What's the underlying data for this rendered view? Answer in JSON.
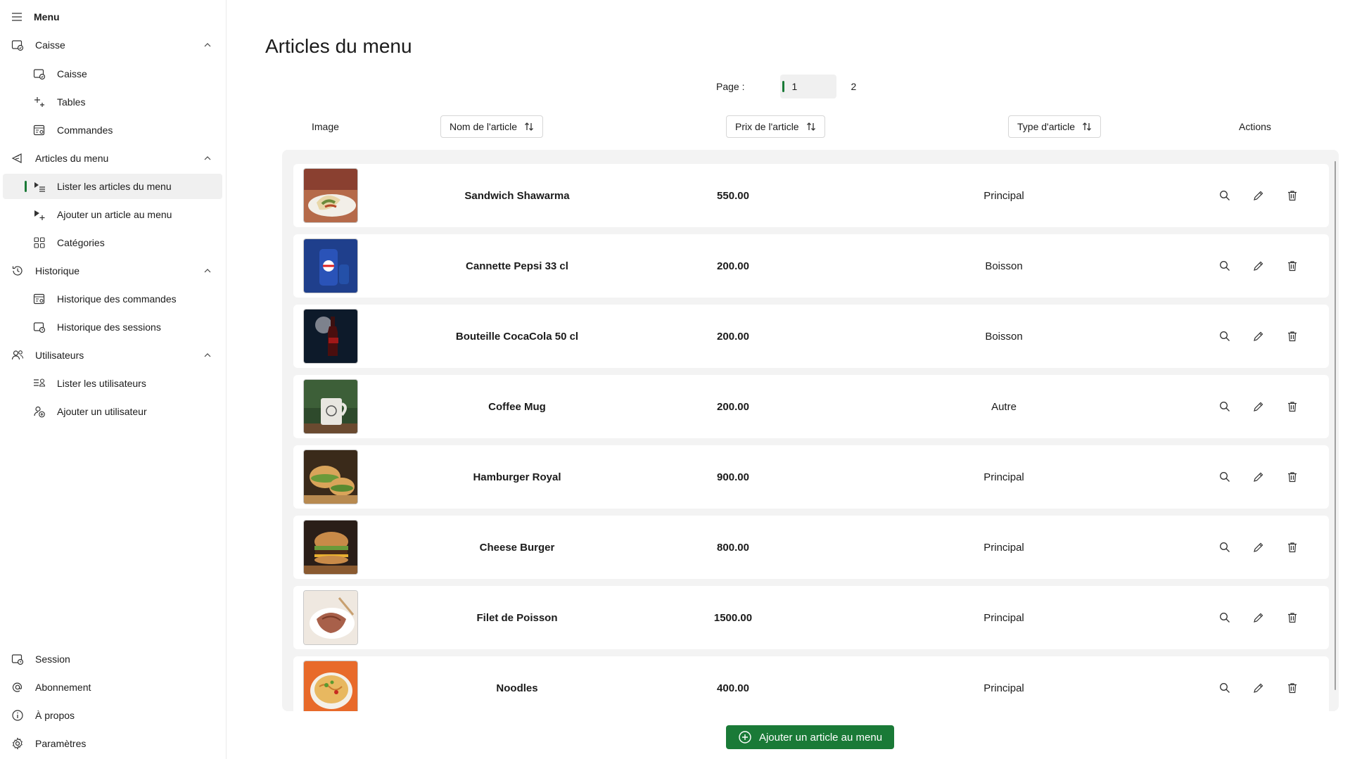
{
  "sidebar": {
    "menu_label": "Menu",
    "caisse_group": "Caisse",
    "caisse": "Caisse",
    "tables": "Tables",
    "commandes": "Commandes",
    "articles_group": "Articles du menu",
    "lister_articles": "Lister les articles du menu",
    "ajouter_article": "Ajouter un article au menu",
    "categories": "Catégories",
    "historique_group": "Historique",
    "historique_commandes": "Historique des commandes",
    "historique_sessions": "Historique des sessions",
    "utilisateurs_group": "Utilisateurs",
    "lister_utilisateurs": "Lister les utilisateurs",
    "ajouter_utilisateur": "Ajouter un utilisateur",
    "session": "Session",
    "abonnement": "Abonnement",
    "apropos": "À propos",
    "parametres": "Paramètres"
  },
  "main": {
    "title": "Articles du menu",
    "page_label": "Page :",
    "page_current": "1",
    "page_next": "2",
    "columns": {
      "image": "Image",
      "name": "Nom de l'article",
      "price": "Prix de l'article",
      "type": "Type d'article",
      "actions": "Actions"
    },
    "items": [
      {
        "name": "Sandwich Shawarma",
        "price": "550.00",
        "type": "Principal"
      },
      {
        "name": "Cannette Pepsi 33 cl",
        "price": "200.00",
        "type": "Boisson"
      },
      {
        "name": "Bouteille CocaCola 50 cl",
        "price": "200.00",
        "type": "Boisson"
      },
      {
        "name": "Coffee Mug",
        "price": "200.00",
        "type": "Autre"
      },
      {
        "name": "Hamburger Royal",
        "price": "900.00",
        "type": "Principal"
      },
      {
        "name": "Cheese Burger",
        "price": "800.00",
        "type": "Principal"
      },
      {
        "name": "Filet de Poisson",
        "price": "1500.00",
        "type": "Principal"
      },
      {
        "name": "Noodles",
        "price": "400.00",
        "type": "Principal"
      }
    ],
    "add_button": "Ajouter un article au menu"
  },
  "colors": {
    "accent": "#1a7a37",
    "selected_bg": "#f0f0f0",
    "list_bg": "#f3f3f3"
  }
}
